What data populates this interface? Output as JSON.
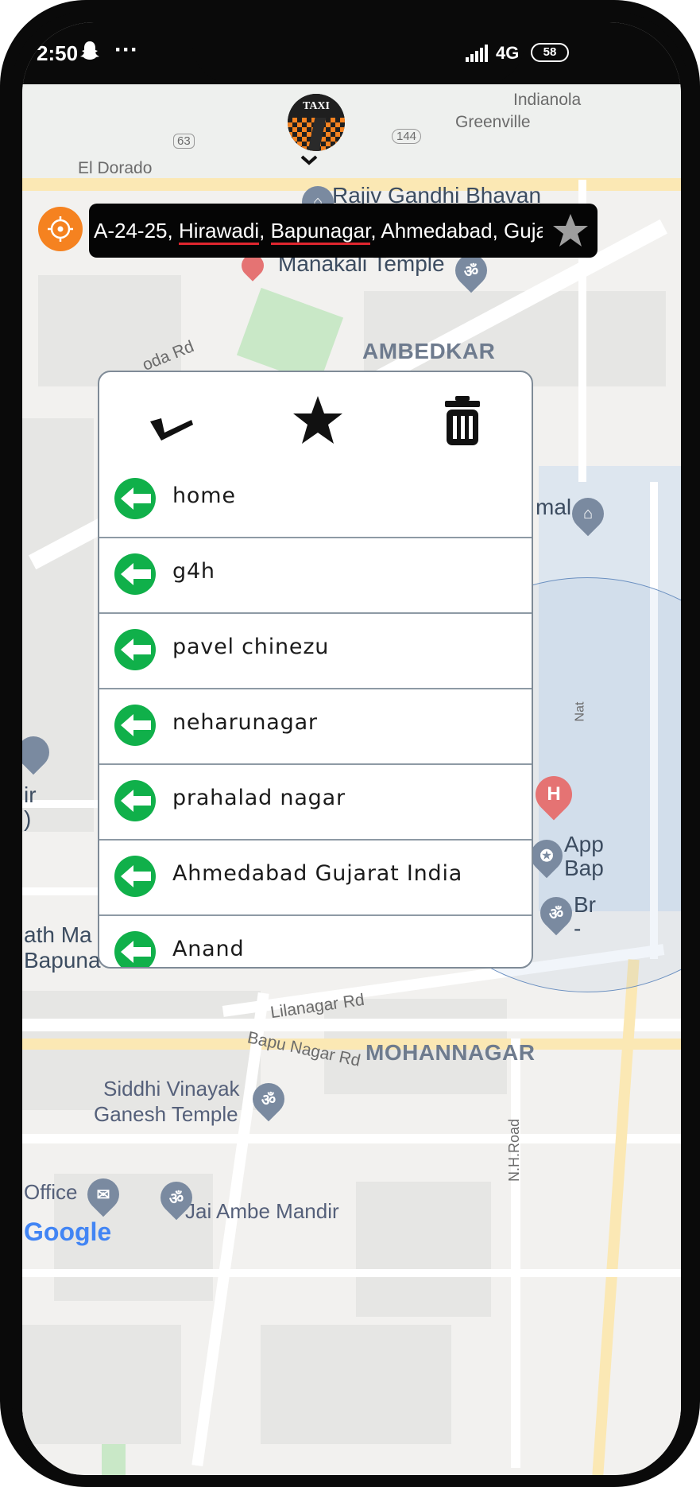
{
  "status_bar": {
    "time": "2:50",
    "dots": "···",
    "network": "4G",
    "battery": "58"
  },
  "map": {
    "labels": {
      "indianola": "Indianola",
      "greenville": "Greenville",
      "el_dorado": "El Dorado",
      "hwy_63": "63",
      "hwy_144": "144",
      "rajiv": "Rajiv Gandhi Bhavan",
      "manakali": "Manakali Temple",
      "oda_rd": "oda Rd",
      "ambedkar": "AMBEDKAR",
      "mal": "mal",
      "ir": "ir",
      "paren": ")",
      "app": "App",
      "bap": "Bap",
      "br": "Br",
      "dash": "-",
      "ath_ma": "ath Ma",
      "bapuna": "Bapuna",
      "lilanagar": "Lilanagar Rd",
      "bapu_nagar_rd": "Bapu Nagar Rd",
      "mohannagar": "MOHANNAGAR",
      "siddhi_1": "Siddhi Vinayak",
      "siddhi_2": "Ganesh Temple",
      "nh_road": "N.H.Road",
      "office": "Office",
      "jai_ambe": "Jai Ambe Mandir",
      "nat": "Nat",
      "google": "Google"
    }
  },
  "header": {
    "logo_text": "TAXI"
  },
  "address": {
    "part1": "A-24-25, ",
    "part2": "Hirawadi",
    "part3": ", ",
    "part4": "Bapunagar",
    "part5": ", Ahmedabad, Gujarat"
  },
  "saved_places": {
    "items": [
      {
        "label": "home"
      },
      {
        "label": "g4h"
      },
      {
        "label": "pavel chinezu"
      },
      {
        "label": "neharunagar"
      },
      {
        "label": "prahalad nagar"
      },
      {
        "label": "Ahmedabad Gujarat India"
      },
      {
        "label": "Anand"
      }
    ]
  },
  "colors": {
    "accent_orange": "#f58220",
    "list_icon_green": "#10b04a",
    "address_bg": "#050505"
  }
}
